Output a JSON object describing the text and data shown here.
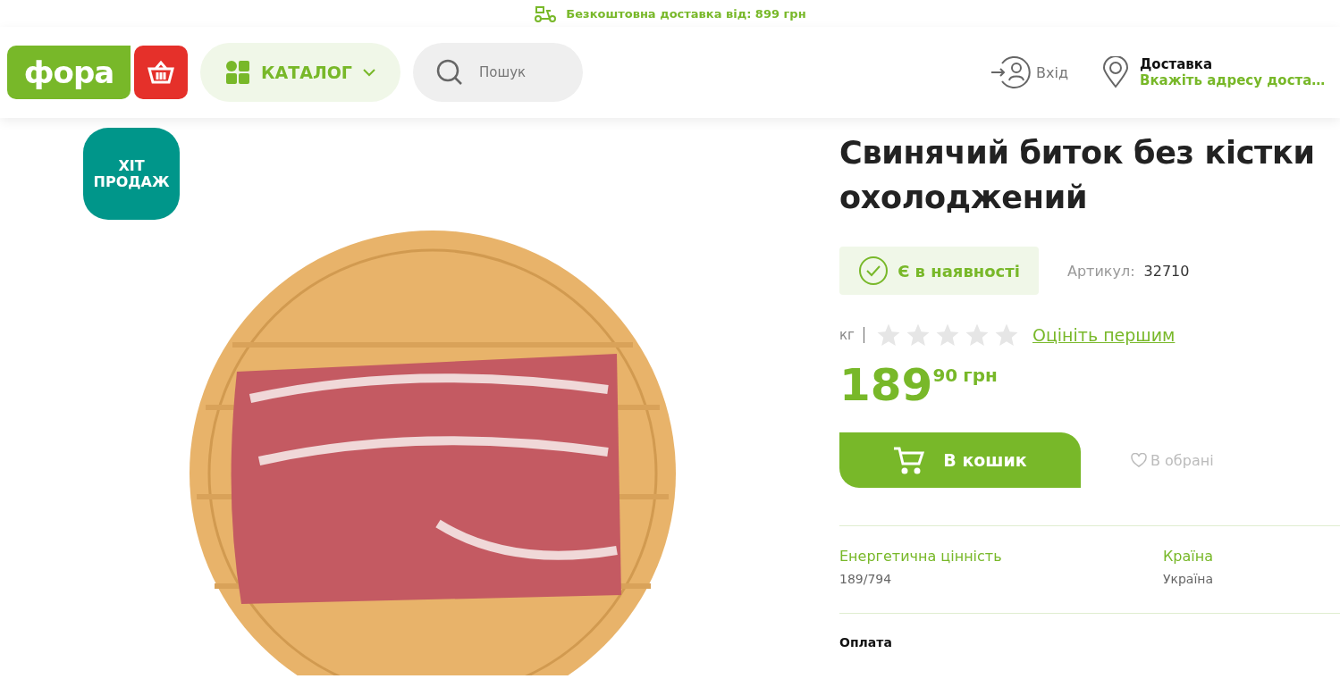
{
  "promo_bar": {
    "text": "Безкоштовна доставка від: 899 грн"
  },
  "header": {
    "logo": "фора",
    "catalog": "КАТАЛОГ",
    "search": {
      "placeholder": "Пошук"
    },
    "login": "Вхід",
    "delivery": {
      "title": "Доставка",
      "address": "Вкажіть адресу доста…"
    }
  },
  "badge": "ХІТ ПРОДАЖ",
  "product": {
    "title": "Свинячий биток без кістки охолоджений",
    "availability": "Є в наявності",
    "article_label": "Артикул:",
    "article": "32710",
    "unit": "кг",
    "stars": 0,
    "rate_link": "Оцініть першим",
    "price_main": "189",
    "price_cents": "90",
    "currency": "грн",
    "cart_button": "В кошик",
    "favorite": "В обрані"
  },
  "specs": [
    {
      "label": "Енергетична цінність",
      "value": "189/794"
    },
    {
      "label": "Країна",
      "value": "Україна"
    }
  ],
  "section_title": "Оплата"
}
